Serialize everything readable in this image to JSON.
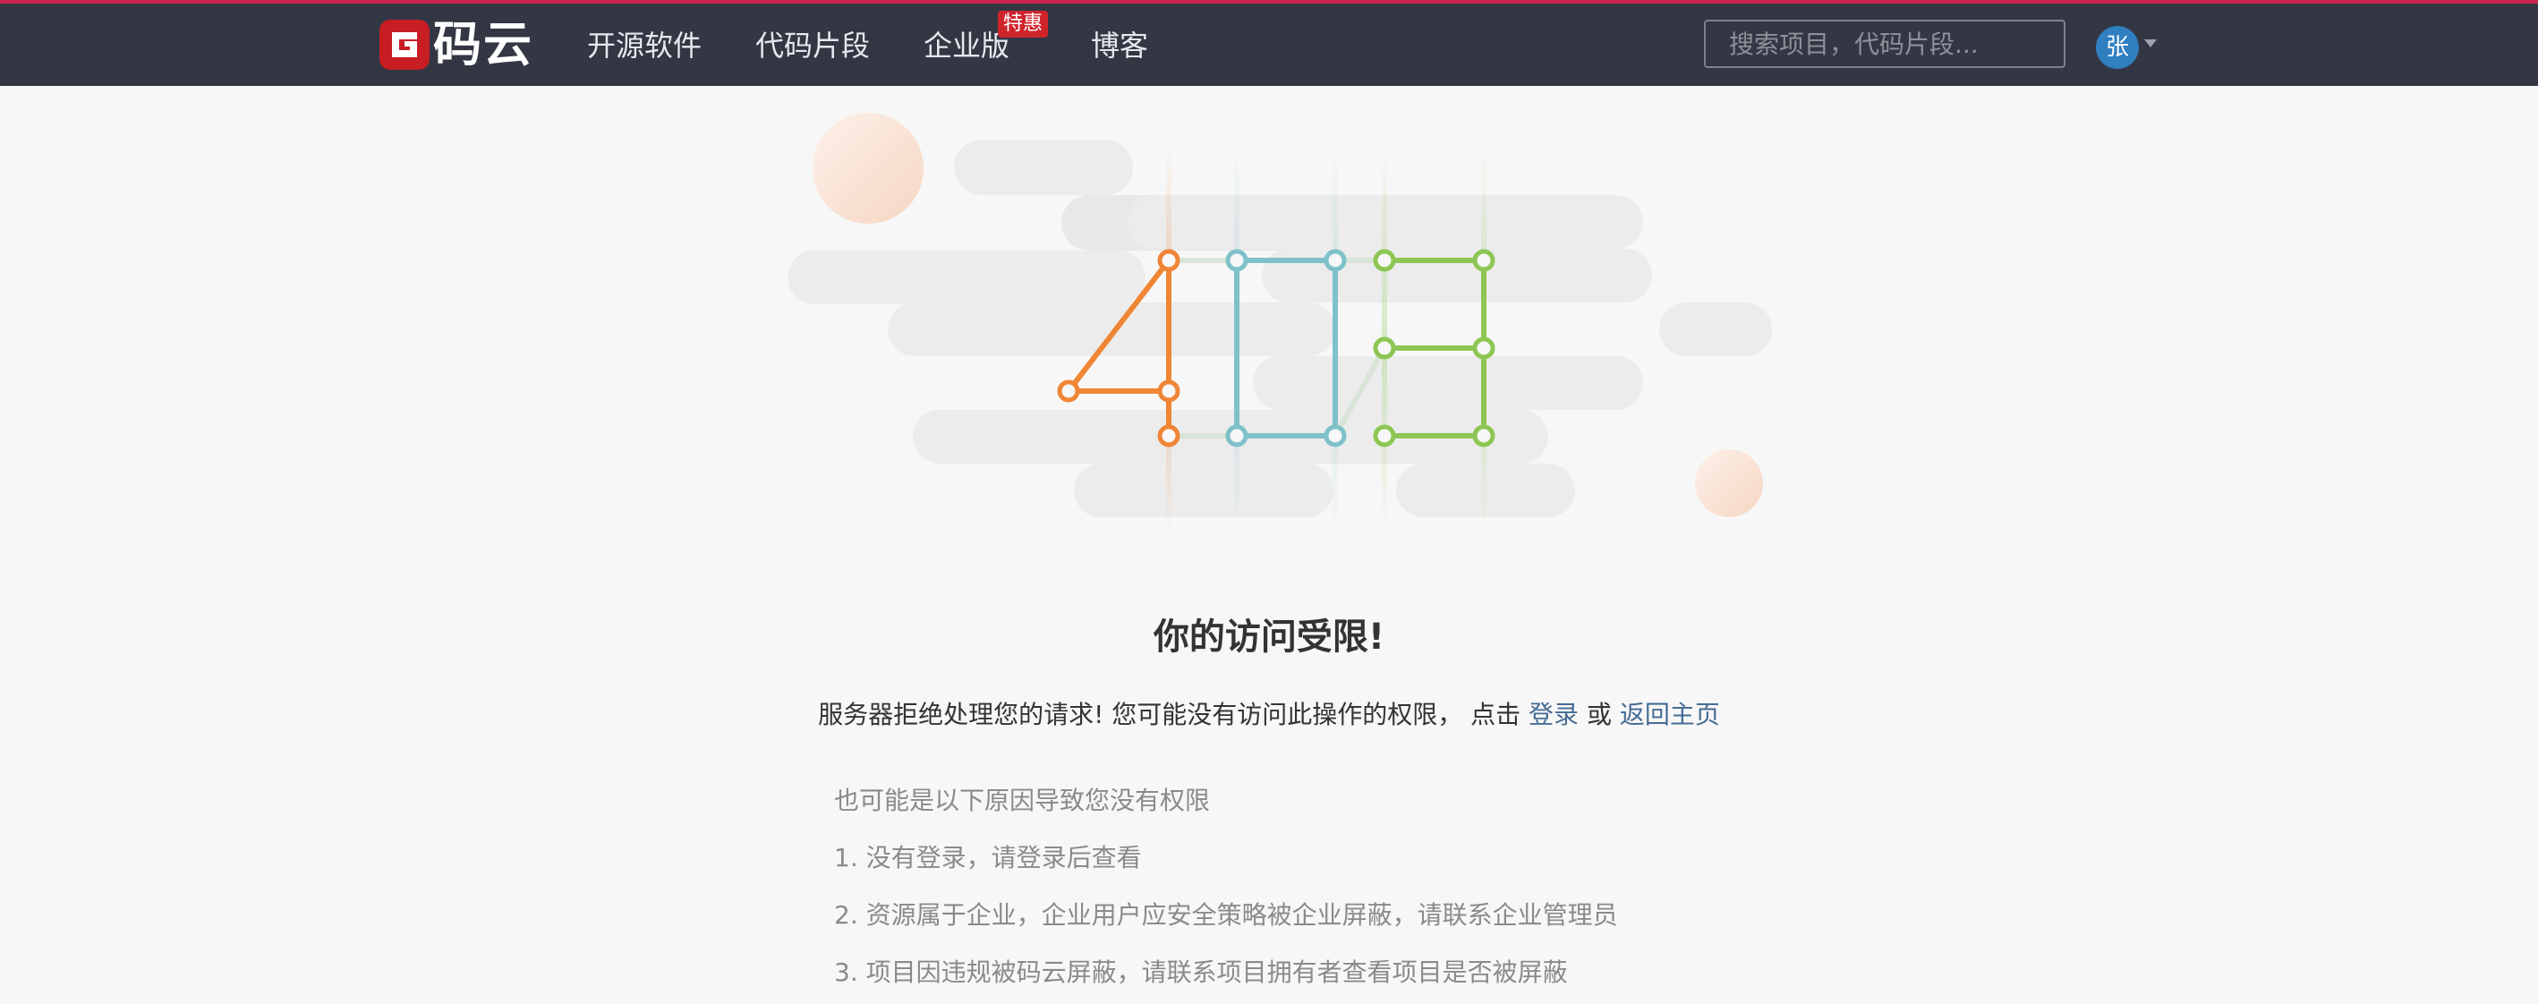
{
  "nav": {
    "brand": "码云",
    "items": [
      "开源软件",
      "代码片段",
      "企业版",
      "博客"
    ],
    "badge": "特惠",
    "search_placeholder": "搜索项目，代码片段...",
    "avatar": "张"
  },
  "error": {
    "code": "403",
    "title": "你的访问受限!",
    "desc_prefix": "服务器拒绝处理您的请求! 您可能没有访问此操作的权限，  点击",
    "login_link": "登录",
    "or": "或",
    "home_link": "返回主页"
  },
  "reasons": {
    "heading": "也可能是以下原因导致您没有权限",
    "items": [
      "1. 没有登录，请登录后查看",
      "2. 资源属于企业，企业用户应安全策略被企业屏蔽，请联系企业管理员",
      "3. 项目因违规被码云屏蔽，请联系项目拥有者查看项目是否被屏蔽"
    ]
  },
  "colors": {
    "nav_bg": "#333744",
    "accent_red": "#d0242b",
    "digit_4": "#f08535",
    "digit_0": "#7fc1c9",
    "digit_3": "#8dc653",
    "link": "#466c94"
  }
}
